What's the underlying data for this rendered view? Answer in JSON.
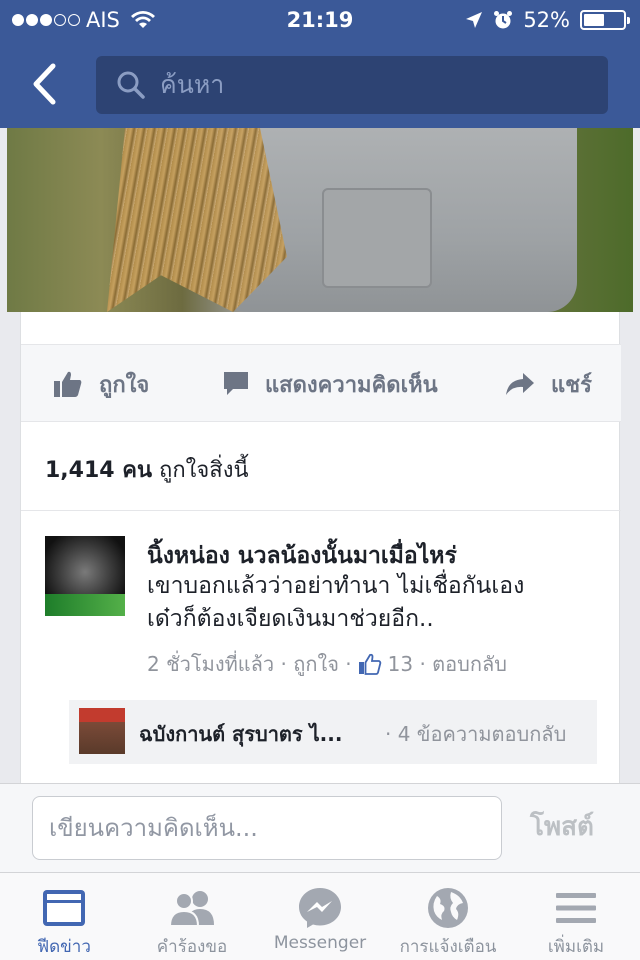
{
  "status_bar": {
    "carrier": "AIS",
    "time": "21:19",
    "battery_percent": "52%",
    "battery_level": 0.52
  },
  "header": {
    "search_placeholder": "ค้นหา",
    "back_icon": "chevron-left-icon",
    "search_icon": "search-icon"
  },
  "post": {
    "actions": {
      "like": "ถูกใจ",
      "comment": "แสดงความคิดเห็น",
      "share": "แชร์"
    },
    "likes_count": "1,414 คน",
    "likes_suffix": "ถูกใจสิ่งนี้"
  },
  "comment": {
    "author": "นิ้งหน่อง นวลน้องนั้นมาเมื่อไหร่",
    "text_line1": "เขาบอกแล้วว่าอย่าทำนา ไม่เชื่อกันเอง",
    "text_line2": "เด๋วก็ต้องเจียดเงินมาช่วยอีก..",
    "time": "2 ชั่วโมงที่แล้ว",
    "like": "ถูกใจ",
    "like_count": "13",
    "reply": "ตอบกลับ"
  },
  "reply_preview": {
    "author": "ฉบังกานต์ สุรบาตร ไ...",
    "count": "· 4 ข้อความตอบกลับ"
  },
  "composer": {
    "placeholder": "เขียนความคิดเห็น...",
    "post_label": "โพสต์"
  },
  "tabs": [
    {
      "label": "ฟีดข่าว",
      "icon": "news-feed-icon",
      "active": true
    },
    {
      "label": "คำร้องขอ",
      "icon": "friend-requests-icon",
      "active": false
    },
    {
      "label": "Messenger",
      "icon": "messenger-icon",
      "active": false
    },
    {
      "label": "การแจ้งเตือน",
      "icon": "globe-icon",
      "active": false
    },
    {
      "label": "เพิ่มเติม",
      "icon": "menu-icon",
      "active": false
    }
  ],
  "colors": {
    "brand": "#3b5998",
    "active_tab": "#4267b2"
  }
}
